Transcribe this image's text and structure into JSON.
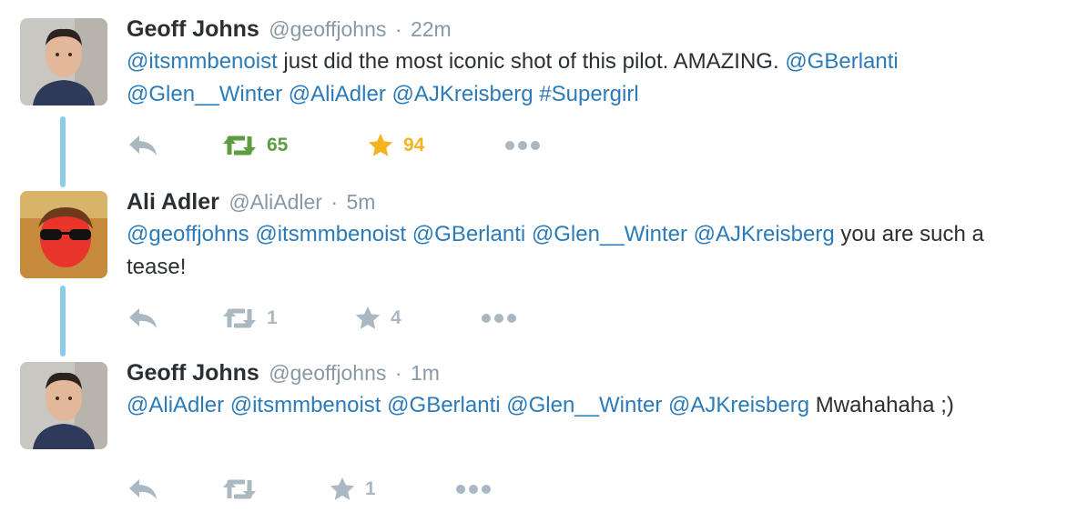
{
  "tweets": [
    {
      "name": "Geoff Johns",
      "handle": "@geoffjohns",
      "dot": "·",
      "time": "22m",
      "text_parts": [
        {
          "t": "@itsmmbenoist",
          "link": true
        },
        {
          "t": " just did the most iconic shot of this pilot. AMAZING. ",
          "link": false
        },
        {
          "t": "@GBerlanti",
          "link": true
        },
        {
          "t": " ",
          "link": false
        },
        {
          "t": "@Glen__Winter",
          "link": true
        },
        {
          "t": " ",
          "link": false
        },
        {
          "t": "@AliAdler",
          "link": true
        },
        {
          "t": " ",
          "link": false
        },
        {
          "t": "@AJKreisberg",
          "link": true
        },
        {
          "t": " ",
          "link": false
        },
        {
          "t": "#Supergirl",
          "link": true
        }
      ],
      "retweets": "65",
      "favorites": "94",
      "retweeted": true,
      "favorited": true,
      "avatar": "geoff-johns-avatar"
    },
    {
      "name": "Ali Adler",
      "handle": "@AliAdler",
      "dot": "·",
      "time": "5m",
      "text_parts": [
        {
          "t": "@geoffjohns",
          "link": true
        },
        {
          "t": " ",
          "link": false
        },
        {
          "t": "@itsmmbenoist",
          "link": true
        },
        {
          "t": " ",
          "link": false
        },
        {
          "t": "@GBerlanti",
          "link": true
        },
        {
          "t": " ",
          "link": false
        },
        {
          "t": "@Glen__Winter",
          "link": true
        },
        {
          "t": " ",
          "link": false
        },
        {
          "t": "@AJKreisberg",
          "link": true
        },
        {
          "t": " you are such a tease!",
          "link": false
        }
      ],
      "retweets": "1",
      "favorites": "4",
      "retweeted": false,
      "favorited": false,
      "avatar": "ali-adler-avatar"
    },
    {
      "name": "Geoff Johns",
      "handle": "@geoffjohns",
      "dot": "·",
      "time": "1m",
      "text_parts": [
        {
          "t": "@AliAdler",
          "link": true
        },
        {
          "t": " ",
          "link": false
        },
        {
          "t": "@itsmmbenoist",
          "link": true
        },
        {
          "t": " ",
          "link": false
        },
        {
          "t": "@GBerlanti",
          "link": true
        },
        {
          "t": " ",
          "link": false
        },
        {
          "t": "@Glen__Winter",
          "link": true
        },
        {
          "t": " ",
          "link": false
        },
        {
          "t": "@AJKreisberg",
          "link": true
        },
        {
          "t": " Mwahahaha ;)",
          "link": false
        }
      ],
      "retweets": "",
      "favorites": "1",
      "retweeted": false,
      "favorited": false,
      "avatar": "geoff-johns-avatar"
    }
  ],
  "colors": {
    "link": "#2b7bb9",
    "retweet_active": "#5c9e3f",
    "favorite_active": "#f5b31f",
    "muted": "#aab8c2",
    "thread_line": "#8ecbe7"
  },
  "icons": {
    "reply": "reply-icon",
    "retweet": "retweet-icon",
    "favorite": "star-icon",
    "more": "more-dots-icon"
  }
}
